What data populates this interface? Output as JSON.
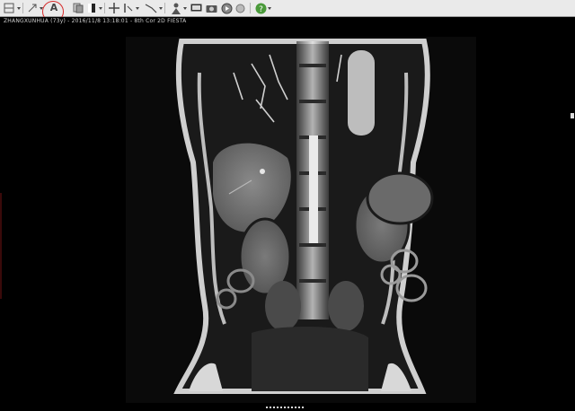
{
  "window": {
    "toolbar_icons": [
      "layout-icon",
      "pan-icon",
      "annotation-text-icon",
      "copy-image-icon",
      "window-level-icon",
      "crosshair-icon",
      "measure-icon",
      "line-icon",
      "person-icon",
      "screen-icon",
      "camera-icon",
      "cine-icon",
      "help-icon"
    ]
  },
  "annotation_tool": {
    "letter": "A"
  },
  "viewer": {
    "info_text": "ZHANGXUNHUA (73y) - 2016/11/8 13:18:01 - 8th Cor 2D FIESTA"
  },
  "colors": {
    "toolbar_bg": "#eaeaea",
    "highlight_circle": "#d62a2a",
    "info_text": "#cfcfcf",
    "viewport_bg": "#000000"
  }
}
